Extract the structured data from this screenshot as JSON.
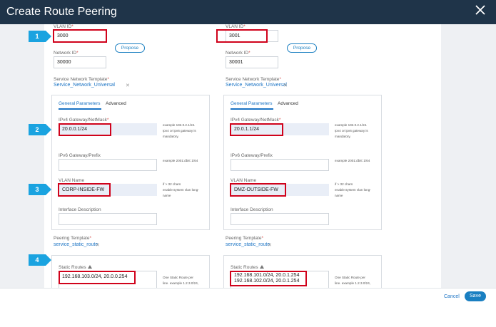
{
  "dialog": {
    "title": "Create Route Peering"
  },
  "common": {
    "vlan_id_label": "VLAN ID",
    "network_id_label": "Network ID",
    "propose_label": "Propose",
    "service_template_label": "Service Network Template",
    "general_tab": "General Parameters",
    "advanced_tab": "Advanced",
    "ipv4_label": "IPv4 Gateway/NetMask",
    "ipv6_label": "IPv6 Gateway/Prefix",
    "vlan_name_label": "VLAN Name",
    "interface_desc_label": "Interface Description",
    "peering_template_label": "Peering Template",
    "static_routes_label": "Static Routes",
    "required_mark": "*",
    "remove_mark": "✕",
    "ipv4_note": "example 192.0.2.1/24. Ipv4 or ipv6 gateway is mandatory.",
    "ipv6_note": "example 2001:db8::1/64",
    "vlan_note": "if > 32 chars enable:system vlan long-name",
    "routes_note": "One Static Route per line. example 1.2.3.0/24, 1.2.2.2"
  },
  "left": {
    "vlan_id": "3000",
    "network_id": "30000",
    "service_template": "Service_Network_Universal",
    "ipv4": "20.0.0.1/24",
    "ipv6": "",
    "vlan_name": "CORP-INSIDE-FW",
    "interface_desc": "",
    "peering_template": "service_static_route",
    "static_routes": [
      "192.168.103.0/24, 20.0.0.254"
    ]
  },
  "right": {
    "vlan_id": "3001",
    "network_id": "30001",
    "service_template": "Service_Network_Universal",
    "ipv4": "20.0.1.1/24",
    "ipv6": "",
    "vlan_name": "DMZ-OUTSIDE-FW",
    "interface_desc": "",
    "peering_template": "service_static_route",
    "static_routes": [
      "192.168.101.0/24, 20.0.1.254",
      "192.168.102.0/24, 20.0.1.254"
    ]
  },
  "callouts": [
    "1",
    "2",
    "3",
    "4"
  ],
  "footer": {
    "cancel_label": "Cancel",
    "save_label": "Save"
  },
  "colors": {
    "header_bg": "#1f3449",
    "accent": "#1a73c4",
    "highlight": "#d0021b",
    "callout": "#1aa3e0"
  }
}
